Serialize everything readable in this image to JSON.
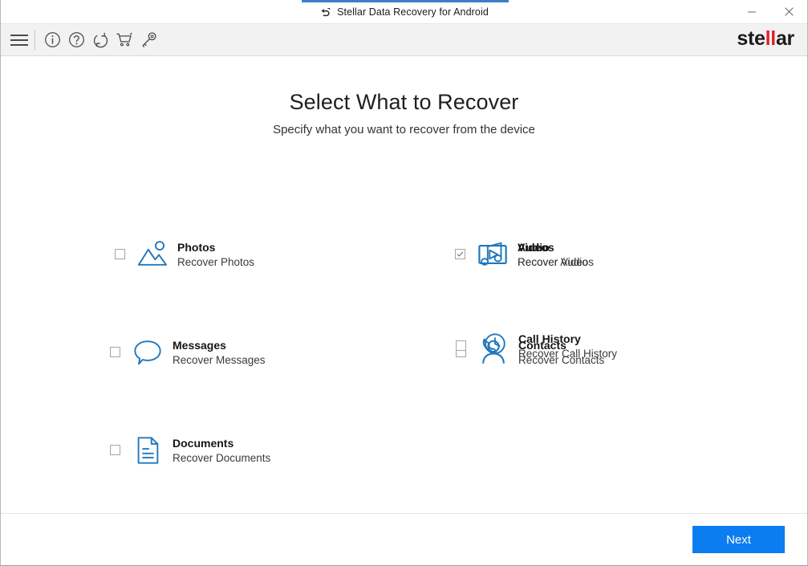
{
  "window": {
    "title": "Stellar Data Recovery for Android",
    "title_icon": "recovery-arrow-icon",
    "minimize_label": "−",
    "close_label": "×"
  },
  "toolbar": {
    "menu_icon": "hamburger-menu-icon",
    "items": [
      {
        "icon": "info-icon",
        "name": "about"
      },
      {
        "icon": "help-icon",
        "name": "help"
      },
      {
        "icon": "refresh-icon",
        "name": "update"
      },
      {
        "icon": "cart-icon",
        "name": "buy"
      },
      {
        "icon": "key-icon",
        "name": "activate"
      }
    ],
    "brand_pre": "ste",
    "brand_mid": "ll",
    "brand_post": "ar"
  },
  "main": {
    "heading": "Select What to Recover",
    "subheading": "Specify what you want to recover from the device",
    "options": [
      {
        "title": "Photos",
        "subtitle": "Recover Photos",
        "checked": false,
        "icon": "photo-icon"
      },
      {
        "title": "Videos",
        "subtitle": "Recover Videos",
        "checked": false,
        "icon": "video-icon"
      },
      {
        "title": "Audio",
        "subtitle": "Recover Audio",
        "checked": true,
        "icon": "audio-icon"
      },
      {
        "title": "Messages",
        "subtitle": "Recover Messages",
        "checked": false,
        "icon": "message-icon"
      },
      {
        "title": "Contacts",
        "subtitle": "Recover Contacts",
        "checked": false,
        "icon": "contacts-icon"
      },
      {
        "title": "Call History",
        "subtitle": "Recover Call History",
        "checked": false,
        "icon": "call-history-icon"
      },
      {
        "title": "Documents",
        "subtitle": "Recover Documents",
        "checked": false,
        "icon": "documents-icon"
      }
    ]
  },
  "footer": {
    "next_label": "Next"
  },
  "colors": {
    "accent_blue": "#0c7cf1",
    "icon_blue": "#2077bd",
    "brand_red": "#e1232b",
    "toolbar_bg": "#f2f2f2"
  }
}
